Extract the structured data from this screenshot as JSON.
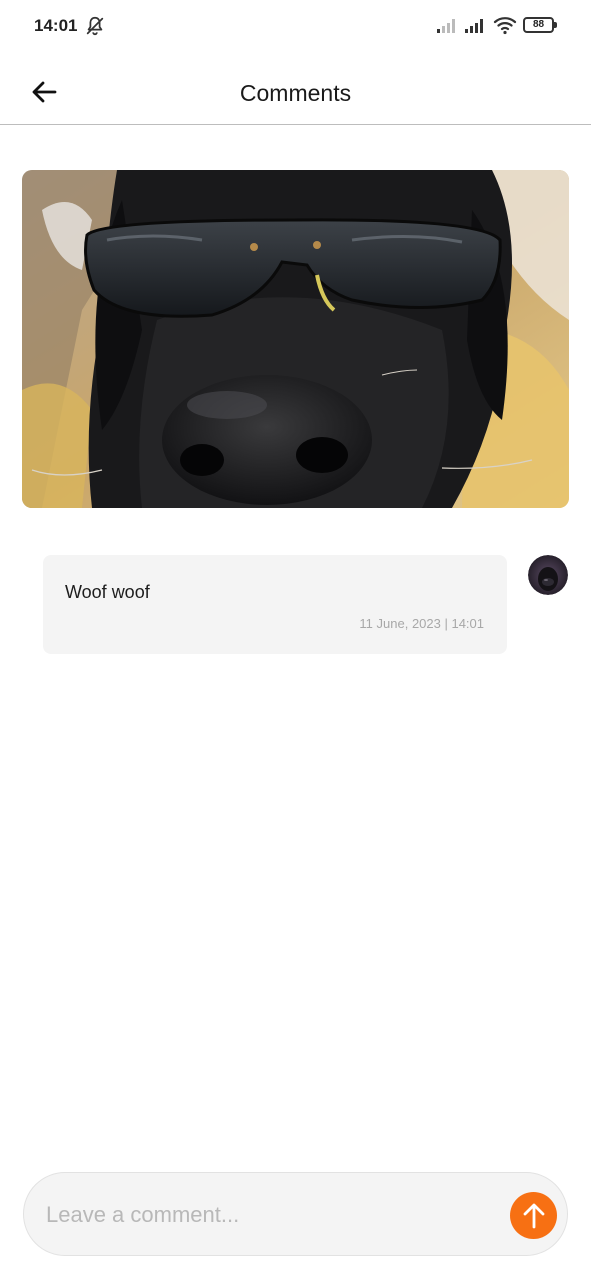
{
  "status_bar": {
    "time": "14:01",
    "battery_level": "88",
    "icons": [
      "notifications-muted-icon",
      "signal-icon",
      "signal-icon",
      "wifi-icon",
      "battery-icon"
    ]
  },
  "header": {
    "title": "Comments",
    "back_icon": "arrow-left-icon"
  },
  "post": {
    "image": "photo of a black dog wearing sunglasses"
  },
  "comments": [
    {
      "text": "Woof woof",
      "timestamp": "11 June, 2023 | 14:01"
    }
  ],
  "composer": {
    "placeholder": "Leave a comment...",
    "value": "",
    "send_icon": "arrow-up-icon"
  },
  "colors": {
    "accent": "#f77013",
    "bubble_background": "#f4f4f4",
    "divider": "#bdbdbd"
  }
}
